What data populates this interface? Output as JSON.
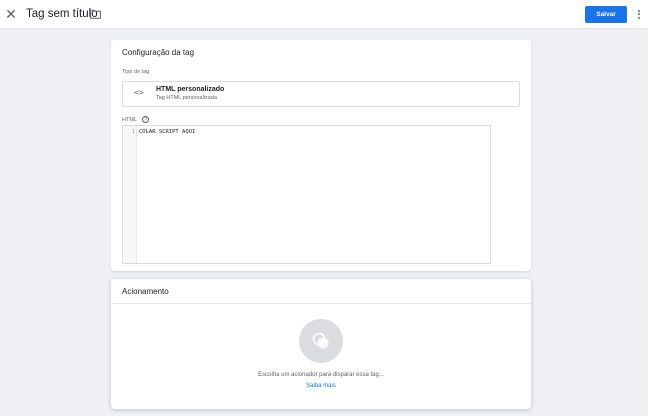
{
  "header": {
    "title": "Tag sem título",
    "save_label": "Salvar"
  },
  "config": {
    "heading": "Configuração da tag",
    "type_label": "Tipo de tag",
    "type_icon_glyph": "<>",
    "type_name": "HTML personalizado",
    "type_sub": "Tag HTML personalizada",
    "html_label": "HTML",
    "editor": {
      "line_number": "1",
      "code": "COLAR SCRIPT AQUI"
    }
  },
  "trigger": {
    "heading": "Acionamento",
    "empty_text": "Escolha um acionador para disparar essa tag...",
    "learn_more": "Saiba mais"
  },
  "colors": {
    "accent": "#1a73e8",
    "background": "#eef0f3"
  },
  "icons": {
    "close": "close-icon",
    "folder": "folder-icon",
    "more": "more-vert-icon",
    "code": "code-icon",
    "help": "help-icon",
    "trigger": "trigger-icon"
  }
}
